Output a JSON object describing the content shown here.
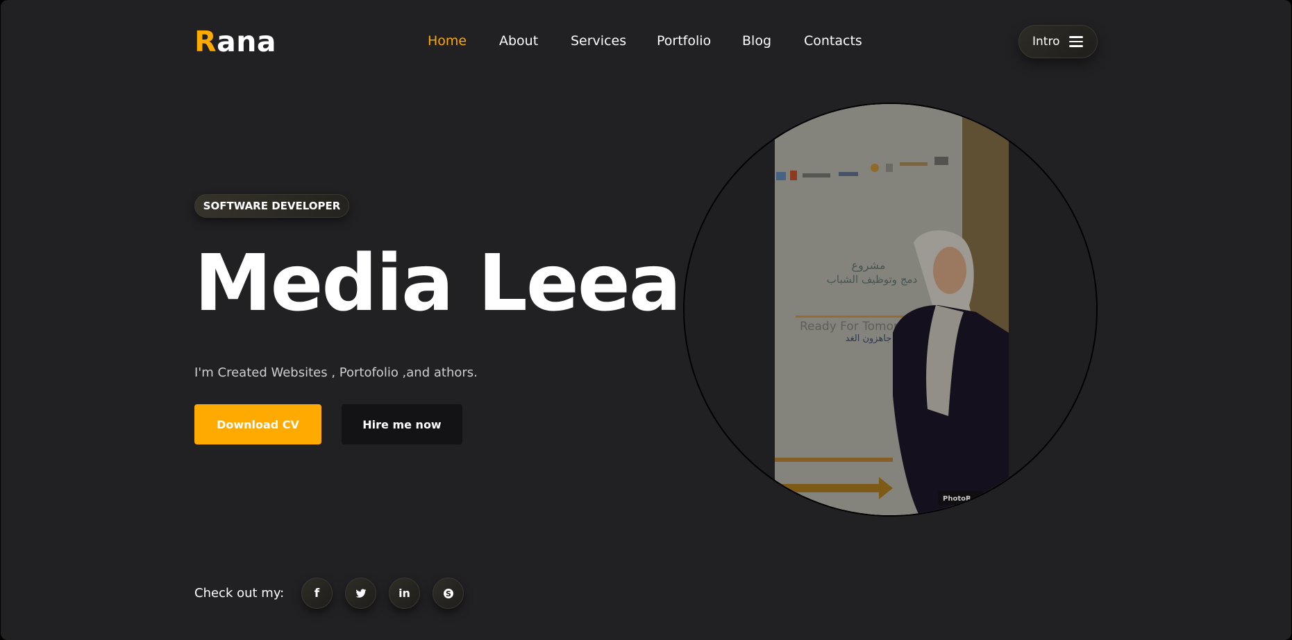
{
  "brand": {
    "initial": "R",
    "rest": "ana",
    "accent_color": "#ffaa00"
  },
  "nav": {
    "items": [
      {
        "label": "Home",
        "active": true
      },
      {
        "label": "About",
        "active": false
      },
      {
        "label": "Services",
        "active": false
      },
      {
        "label": "Portfolio",
        "active": false
      },
      {
        "label": "Blog",
        "active": false
      },
      {
        "label": "Contacts",
        "active": false
      }
    ],
    "menu_button": {
      "label": "Intro",
      "icon": "hamburger-icon"
    }
  },
  "hero": {
    "badge": "SOFTWARE DEVELOPER",
    "title": "Media Leea",
    "subtitle": "I'm Created Websites , Portofolio ,and athors.",
    "primary_button": "Download CV",
    "secondary_button": "Hire me now"
  },
  "social": {
    "label": "Check out my:",
    "icons": [
      "facebook-icon",
      "twitter-icon",
      "linkedin-icon",
      "skype-icon"
    ]
  },
  "portrait": {
    "banner_arabic_line1": "مشروع",
    "banner_arabic_line2": "دمج وتوظيف الشباب",
    "banner_english": "Ready For Tomorrow",
    "banner_arabic_line3": "جاهزون الغد",
    "watermark": "PhotoR"
  },
  "colors": {
    "background": "#212023",
    "accent": "#ffaa00",
    "dark_button": "#131214"
  }
}
